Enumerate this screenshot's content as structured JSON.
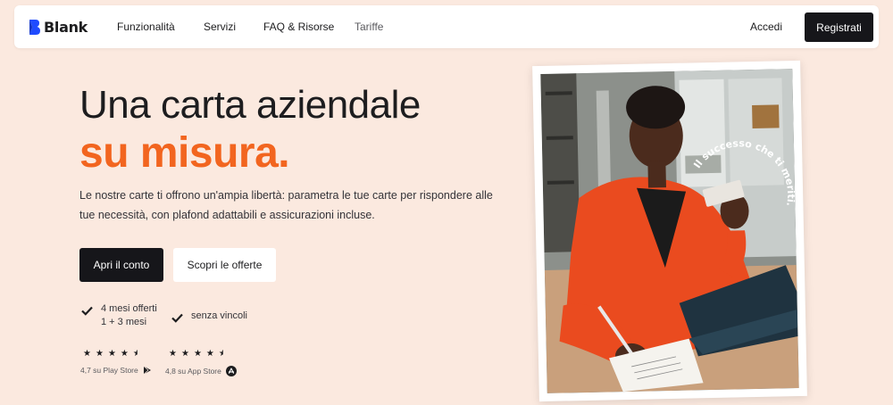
{
  "nav": {
    "logo_text": "Blank",
    "links": [
      "Funzionalità",
      "Servizi",
      "FAQ & Risorse",
      "Tariffe"
    ],
    "login_label": "Accedi",
    "register_label": "Registrati"
  },
  "hero": {
    "title": "Una carta aziendale",
    "title_accent": "su misura.",
    "description": "Le nostre carte ti offrono un'ampia libertà: parametra le tue carte per rispondere alle tue necessità, con plafond adattabili e assicurazioni incluse.",
    "primary_cta": "Apri il conto",
    "secondary_cta": "Scopri le offerte"
  },
  "perks": [
    {
      "line1": "4 mesi offerti",
      "line2": "1 + 3 mesi"
    },
    {
      "line1": "senza vincoli",
      "line2": ""
    }
  ],
  "ratings": [
    {
      "label": "4,7 su Play Store",
      "stars": 4.5,
      "icon": "play-store-icon"
    },
    {
      "label": "4,8 su App Store",
      "stars": 4.5,
      "icon": "app-store-icon"
    }
  ],
  "photo": {
    "caption_arc": "Il successo che ti meriti."
  },
  "colors": {
    "background": "#fbe9df",
    "accent": "#f2651f",
    "dark": "#16161a",
    "logo_blue": "#1f4bff"
  }
}
